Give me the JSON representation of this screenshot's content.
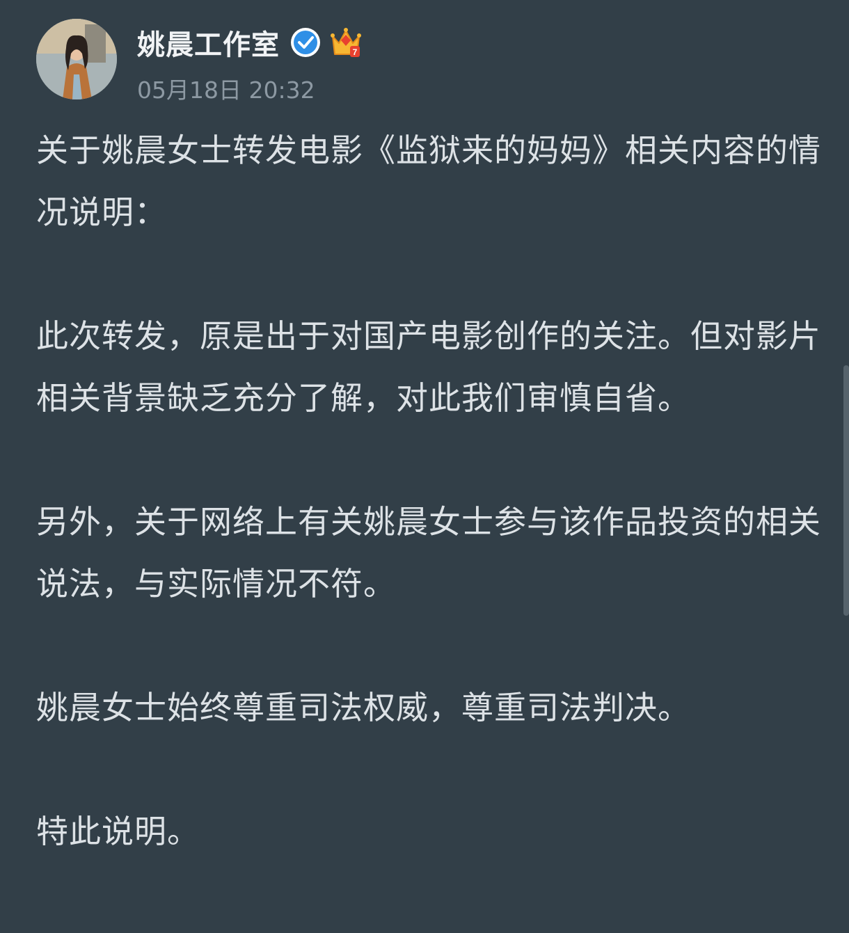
{
  "post": {
    "author": {
      "name": "姚晨工作室",
      "avatar_alt": "avatar",
      "verified_icon": "verified-badge-icon",
      "member_icon": "crown-member-icon",
      "member_level": "7"
    },
    "timestamp": "05月18日 20:32",
    "paragraphs": [
      "关于姚晨女士转发电影《监狱来的妈妈》相关内容的情况说明：",
      "此次转发，原是出于对国产电影创作的关注。但对影片相关背景缺乏充分了解，对此我们审慎自省。",
      "另外，关于网络上有关姚晨女士参与该作品投资的相关说法，与实际情况不符。",
      "姚晨女士始终尊重司法权威，尊重司法判决。",
      "特此说明。"
    ]
  },
  "colors": {
    "background": "#323f48",
    "text": "#dde2e6",
    "muted": "#8d99a3",
    "verified_blue": "#2f8fe6",
    "crown_gold": "#f7b733"
  }
}
